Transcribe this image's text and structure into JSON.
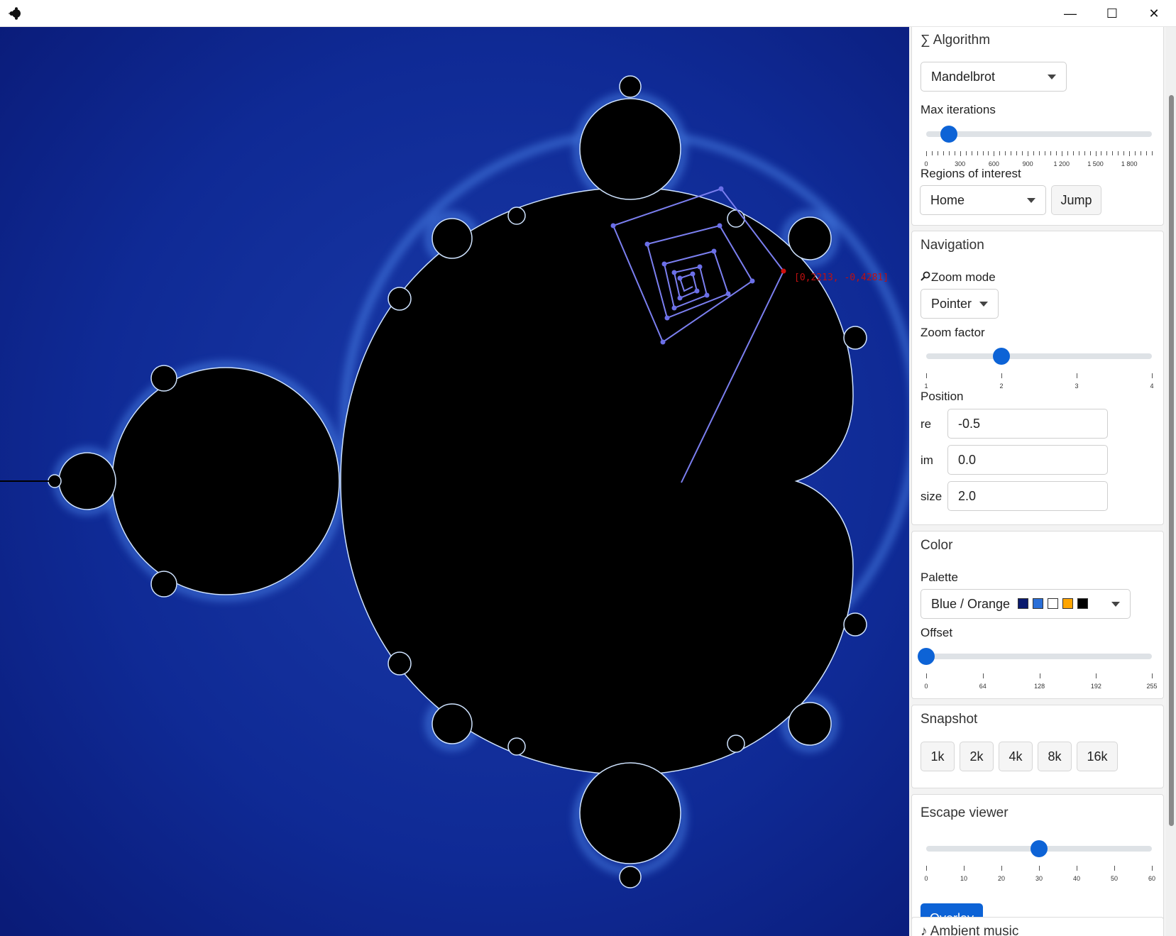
{
  "window": {
    "minimize_glyph": "—",
    "maximize_glyph": "☐",
    "close_glyph": "✕"
  },
  "viewer": {
    "coord_label": "[0,2213, -0,4281]"
  },
  "algorithm": {
    "title": "∑ Algorithm",
    "selected": "Mandelbrot",
    "max_iterations_label": "Max iterations",
    "max_iterations_value": 200,
    "max_iterations_range": [
      0,
      2000
    ],
    "max_iterations_ticks": [
      "0",
      "300",
      "600",
      "900",
      "1 200",
      "1 500",
      "1 800"
    ],
    "regions_label": "Regions of interest",
    "region_selected": "Home",
    "jump_label": "Jump"
  },
  "navigation": {
    "title": "Navigation",
    "zoom_mode_label": "Zoom mode",
    "zoom_mode_selected": "Pointer",
    "zoom_factor_label": "Zoom factor",
    "zoom_factor_value": 2,
    "zoom_factor_range": [
      1,
      4
    ],
    "zoom_factor_ticks": [
      "1",
      "2",
      "3",
      "4"
    ],
    "position_label": "Position",
    "re_label": "re",
    "re_value": "-0.5",
    "im_label": "im",
    "im_value": "0.0",
    "size_label": "size",
    "size_value": "2.0"
  },
  "color": {
    "title": "Color",
    "palette_label": "Palette",
    "palette_selected": "Blue / Orange",
    "palette_swatches": [
      "#0a1a6e",
      "#2a6fd8",
      "#ffffff",
      "#ffa500",
      "#000000"
    ],
    "offset_label": "Offset",
    "offset_value": 0,
    "offset_range": [
      0,
      255
    ],
    "offset_ticks": [
      "0",
      "64",
      "128",
      "192",
      "255"
    ]
  },
  "snapshot": {
    "title": "Snapshot",
    "buttons": [
      "1k",
      "2k",
      "4k",
      "8k",
      "16k"
    ]
  },
  "escape_viewer": {
    "title": "Escape viewer",
    "value": 30,
    "range": [
      0,
      60
    ],
    "ticks": [
      "0",
      "10",
      "20",
      "30",
      "40",
      "50",
      "60"
    ],
    "overlay_label": "Overlay"
  },
  "ambient": {
    "title": "♪ Ambient music"
  }
}
